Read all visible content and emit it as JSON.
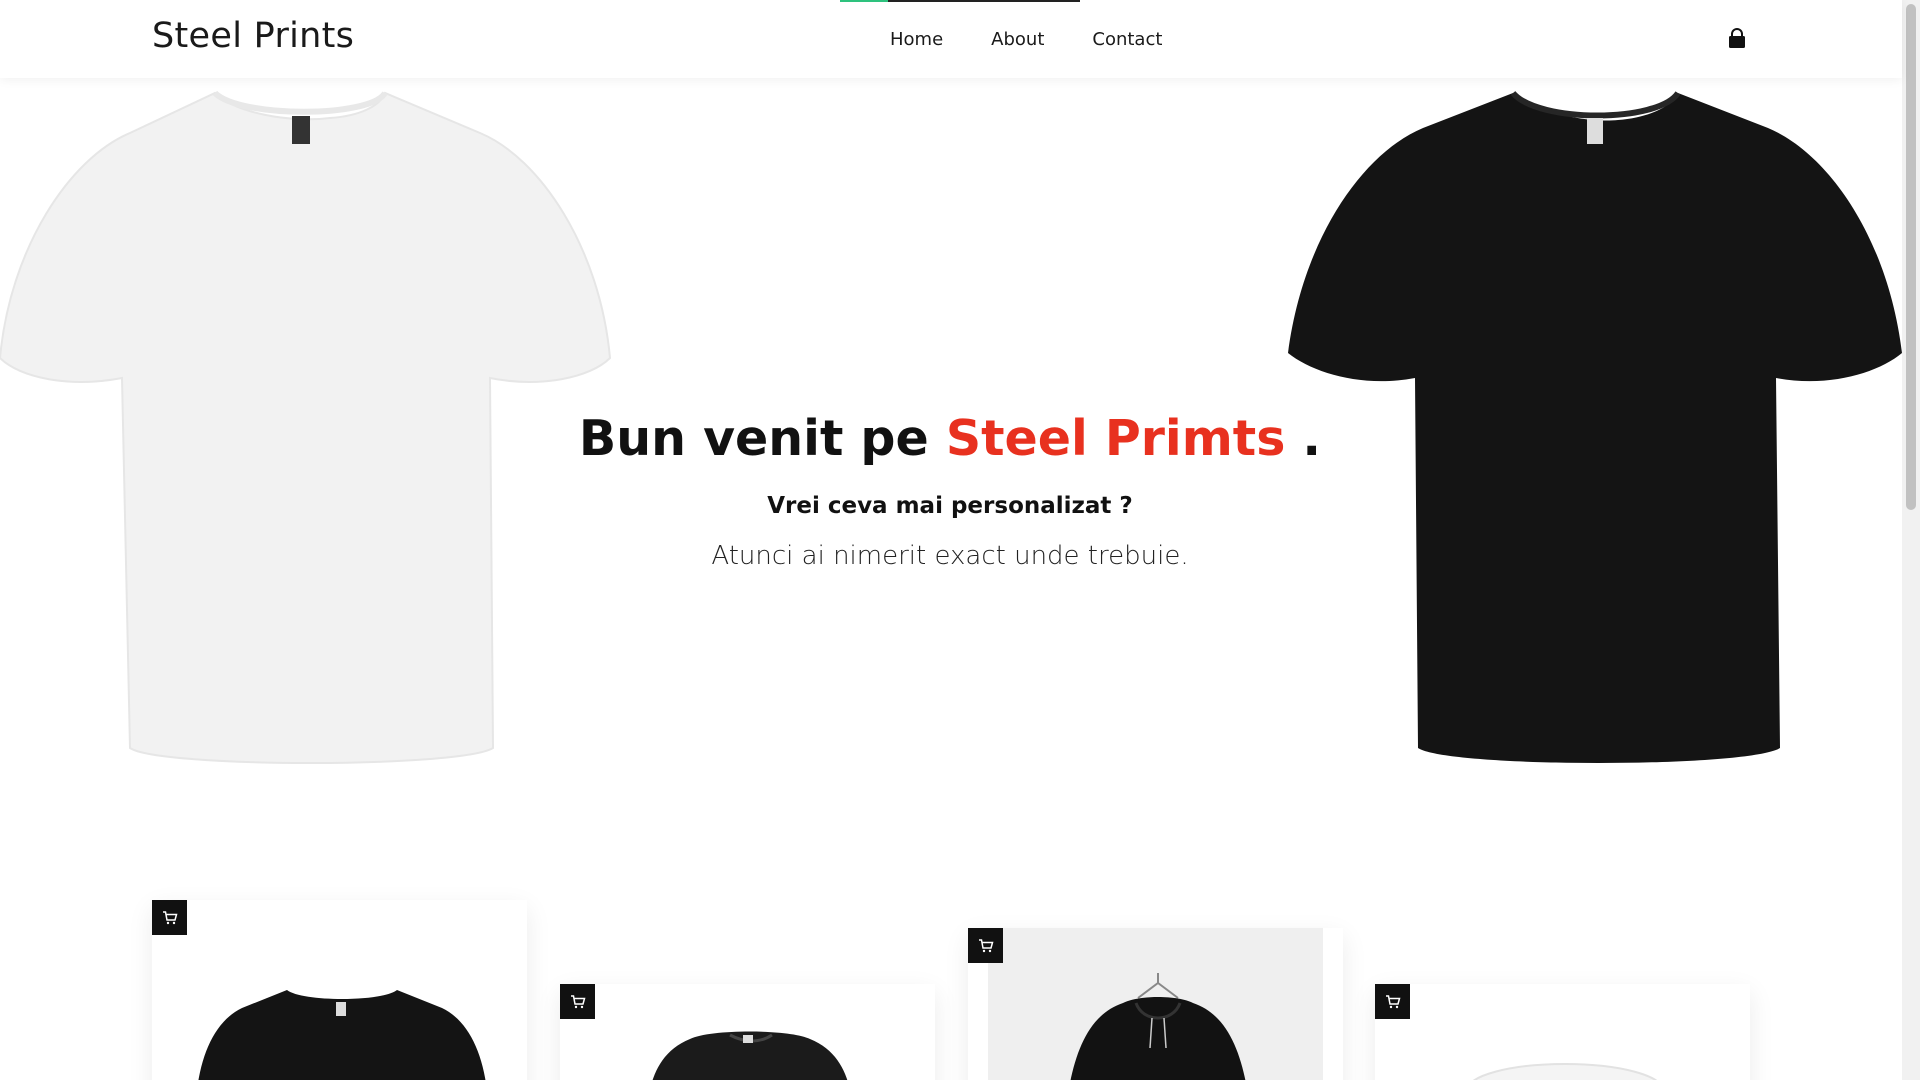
{
  "header": {
    "brand": "Steel Prints",
    "nav": [
      {
        "label": "Home"
      },
      {
        "label": "About"
      },
      {
        "label": "Contact"
      }
    ],
    "cart_icon": "shopping-bag-icon"
  },
  "hero": {
    "title_prefix": "Bun venit pe ",
    "title_accent": "Steel Primts",
    "title_suffix": " .",
    "subtitle": "Vrei ceva mai personalizat ?",
    "description": "Atunci ai nimerit exact unde trebuie.",
    "accent_color": "#e8311f"
  },
  "products": [
    {
      "image": "black-tshirt"
    },
    {
      "image": "black-tshirt-folded"
    },
    {
      "image": "black-hoodie"
    },
    {
      "image": "white-mug"
    }
  ],
  "colors": {
    "nav_active": "#2ec27e",
    "cart_button": "#111111"
  }
}
